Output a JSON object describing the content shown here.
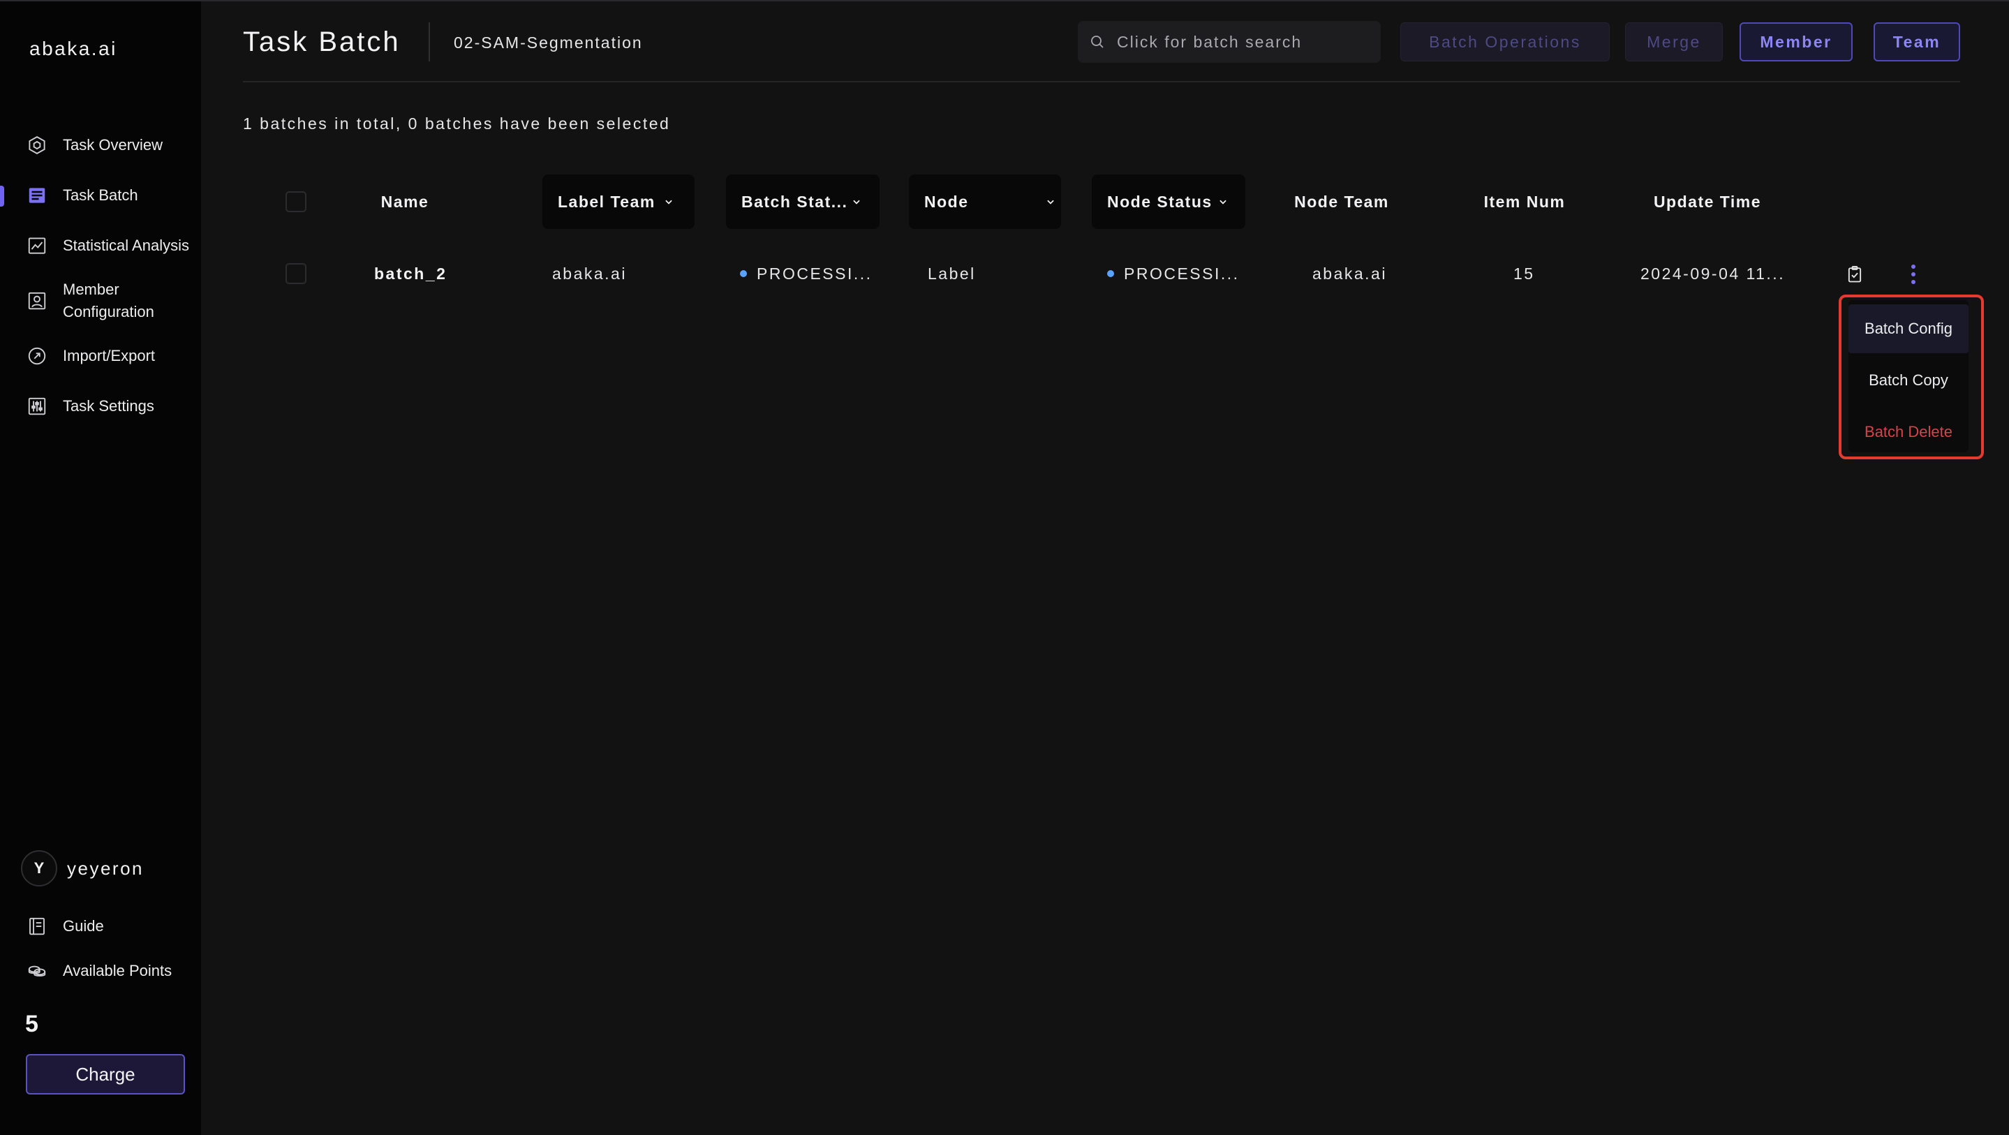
{
  "sidebar": {
    "brand": "abaka.ai",
    "nav": [
      {
        "label": "Task Overview",
        "icon": "cube-icon"
      },
      {
        "label": "Task Batch",
        "icon": "batch-list-icon",
        "active": true
      },
      {
        "label": "Statistical Analysis",
        "icon": "chart-icon"
      },
      {
        "label_line1": "Member",
        "label_line2": "Configuration",
        "icon": "member-icon"
      },
      {
        "label": "Import/Export",
        "icon": "import-export-icon"
      },
      {
        "label": "Task Settings",
        "icon": "settings-sliders-icon"
      }
    ],
    "user": {
      "initial": "Y",
      "name": "yeyeron"
    },
    "guide_label": "Guide",
    "points_label": "Available Points",
    "points_value": "5",
    "charge_label": "Charge"
  },
  "header": {
    "title": "Task Batch",
    "task_name": "02-SAM-Segmentation",
    "search_placeholder": "Click for batch search",
    "buttons": {
      "batch_operations": "Batch Operations",
      "merge": "Merge",
      "member": "Member",
      "team": "Team"
    }
  },
  "summary": "1 batches in total, 0 batches have been selected",
  "table": {
    "columns": {
      "name": "Name",
      "label_team": "Label Team",
      "batch_status": "Batch Stat...",
      "node": "Node",
      "node_status": "Node Status",
      "node_team": "Node Team",
      "item_num": "Item Num",
      "update_time": "Update Time"
    },
    "rows": [
      {
        "name": "batch_2",
        "label_team": "abaka.ai",
        "batch_status": "PROCESSI...",
        "node": "Label",
        "node_status": "PROCESSI...",
        "node_team": "abaka.ai",
        "item_num": "15",
        "update_time": "2024-09-04 11..."
      }
    ]
  },
  "dropdown": {
    "items": [
      "Batch Config",
      "Batch Copy",
      "Batch Delete"
    ]
  },
  "colors": {
    "accent": "#6f63f2",
    "status_dot": "#5aa2ff",
    "danger": "#d9424b",
    "highlight": "#e53a2f"
  }
}
